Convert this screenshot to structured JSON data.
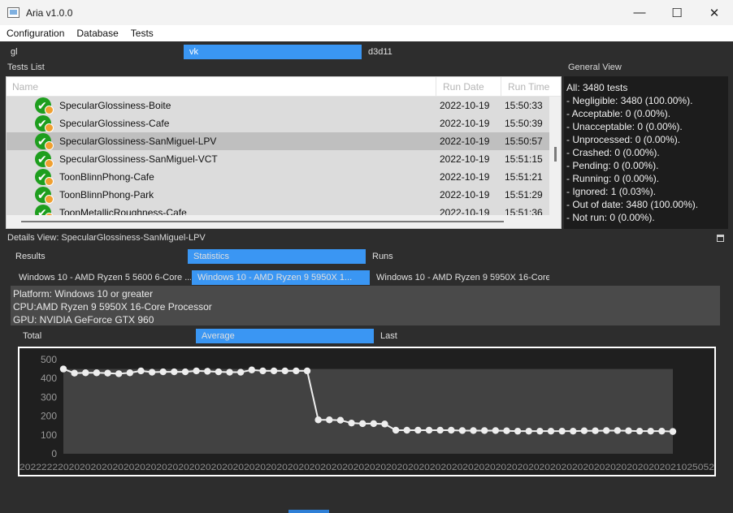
{
  "window": {
    "title": "Aria v1.0.0",
    "controls": {
      "minimize": "—",
      "maximize": "☐",
      "close": "✕"
    }
  },
  "menu": [
    "Configuration",
    "Database",
    "Tests"
  ],
  "api_selector": {
    "options": [
      "gl",
      "vk",
      "d3d11"
    ],
    "selected": "vk"
  },
  "tests_list": {
    "label": "Tests List",
    "columns": [
      "Name",
      "Run Date",
      "Run Time"
    ],
    "rows": [
      {
        "name": "SpecularGlossiness-Boite",
        "date": "2022-10-19",
        "time": "15:50:33"
      },
      {
        "name": "SpecularGlossiness-Cafe",
        "date": "2022-10-19",
        "time": "15:50:39"
      },
      {
        "name": "SpecularGlossiness-SanMiguel-LPV",
        "date": "2022-10-19",
        "time": "15:50:57"
      },
      {
        "name": "SpecularGlossiness-SanMiguel-VCT",
        "date": "2022-10-19",
        "time": "15:51:15"
      },
      {
        "name": "ToonBlinnPhong-Cafe",
        "date": "2022-10-19",
        "time": "15:51:21"
      },
      {
        "name": "ToonBlinnPhong-Park",
        "date": "2022-10-19",
        "time": "15:51:29"
      },
      {
        "name": "ToonMetallicRoughness-Cafe",
        "date": "2022-10-19",
        "time": "15:51:36"
      }
    ],
    "selected_index": 2
  },
  "general_view": {
    "label": "General View",
    "lines": [
      "All: 3480 tests",
      "- Negligible: 3480 (100.00%).",
      "- Acceptable: 0 (0.00%).",
      "- Unacceptable: 0 (0.00%).",
      "- Unprocessed: 0 (0.00%).",
      "- Crashed: 0 (0.00%).",
      "- Pending: 0 (0.00%).",
      "- Running: 0 (0.00%).",
      "- Ignored: 1 (0.03%).",
      "- Out of date: 3480 (100.00%).",
      "- Not run: 0 (0.00%)."
    ]
  },
  "details": {
    "label": "Details View: SpecularGlossiness-SanMiguel-LPV",
    "view_tabs": {
      "options": [
        "Results",
        "Statistics",
        "Runs"
      ],
      "selected": "Statistics"
    },
    "platform_tabs": {
      "options": [
        "Windows 10 - AMD Ryzen 5 5600 6-Core ...",
        "Windows 10 - AMD Ryzen 9 5950X 1...",
        "Windows 10 - AMD Ryzen 9 5950X 16-Core..."
      ],
      "selected_index": 1
    },
    "platform_info": [
      "Platform: Windows 10 or greater",
      "CPU:AMD Ryzen 9 5950X 16-Core Processor",
      "GPU: NVIDIA GeForce GTX 960"
    ],
    "metric_tabs": {
      "options": [
        "Total",
        "Average",
        "Last"
      ],
      "selected": "Average"
    }
  },
  "colors": {
    "accent": "#3a96f3",
    "chart_background": "#1f1f1f",
    "plot_area": "#424242",
    "line": "#eeeeee"
  },
  "chart_data": {
    "type": "line",
    "title": "",
    "xlabel": "",
    "ylabel": "",
    "ylim": [
      0,
      500
    ],
    "yticks": [
      0,
      100,
      200,
      300,
      400,
      500
    ],
    "x_tick_labels_visible": "overlapping date labels (illegible)",
    "series": [
      {
        "values": [
          450,
          428,
          430,
          430,
          428,
          425,
          430,
          440,
          433,
          435,
          435,
          435,
          440,
          438,
          435,
          433,
          433,
          445,
          440,
          440,
          440,
          440,
          440,
          180,
          180,
          178,
          163,
          160,
          160,
          158,
          125,
          125,
          125,
          125,
          125,
          125,
          123,
          123,
          123,
          123,
          122,
          120,
          120,
          120,
          120,
          120,
          120,
          122,
          122,
          123,
          123,
          122,
          120,
          120,
          120,
          118
        ]
      }
    ]
  }
}
